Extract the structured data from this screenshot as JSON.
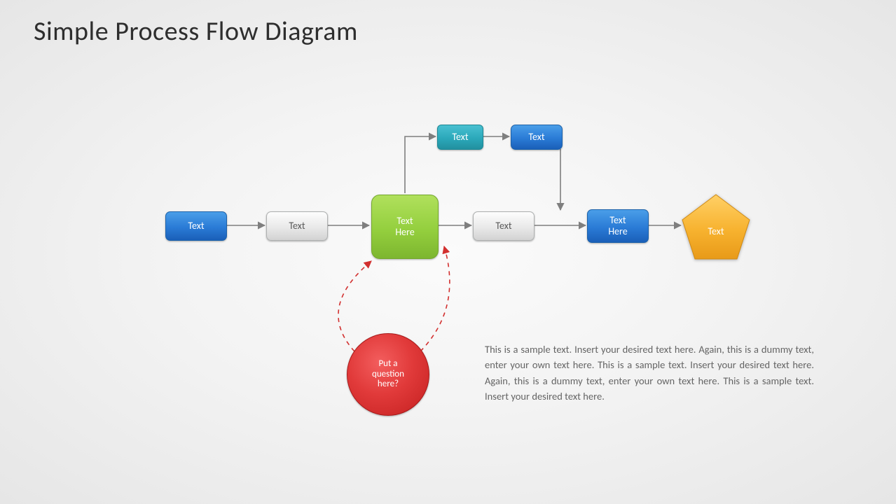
{
  "title": "Simple Process Flow Diagram",
  "nodes": {
    "n1": "Text",
    "n2": "Text",
    "n3": "Text\nHere",
    "n4": "Text",
    "n5": "Text\nHere",
    "n6": "Text",
    "nt1": "Text",
    "nt2": "Text",
    "circle": "Put a\nquestion\nhere?"
  },
  "description": "This is a sample text. Insert your desired text here. Again, this is a dummy text, enter your own text here. This is a sample text. Insert your desired text here. Again, this is a dummy text, enter your own text here. This is a sample text. Insert your desired text here."
}
